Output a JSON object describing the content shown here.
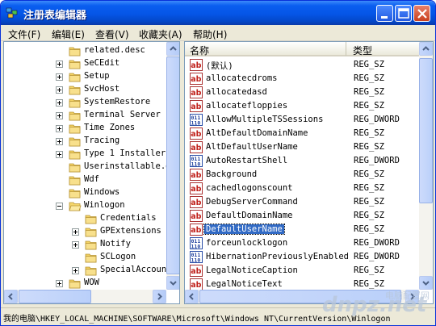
{
  "window": {
    "title": "注册表编辑器"
  },
  "menu": [
    {
      "label": "文件(F)"
    },
    {
      "label": "编辑(E)"
    },
    {
      "label": "查看(V)"
    },
    {
      "label": "收藏夹(A)"
    },
    {
      "label": "帮助(H)"
    }
  ],
  "tree": [
    {
      "label": "related.desc",
      "level": 0,
      "expander": "none"
    },
    {
      "label": "SeCEdit",
      "level": 0,
      "expander": "plus"
    },
    {
      "label": "Setup",
      "level": 0,
      "expander": "plus"
    },
    {
      "label": "SvcHost",
      "level": 0,
      "expander": "plus"
    },
    {
      "label": "SystemRestore",
      "level": 0,
      "expander": "plus"
    },
    {
      "label": "Terminal Server",
      "level": 0,
      "expander": "plus"
    },
    {
      "label": "Time Zones",
      "level": 0,
      "expander": "plus"
    },
    {
      "label": "Tracing",
      "level": 0,
      "expander": "plus"
    },
    {
      "label": "Type 1 Installer",
      "level": 0,
      "expander": "plus"
    },
    {
      "label": "Userinstallable.d",
      "level": 0,
      "expander": "none"
    },
    {
      "label": "Wdf",
      "level": 0,
      "expander": "none"
    },
    {
      "label": "Windows",
      "level": 0,
      "expander": "none"
    },
    {
      "label": "Winlogon",
      "level": 0,
      "expander": "minus",
      "open": true
    },
    {
      "label": "Credentials",
      "level": 1,
      "expander": "none"
    },
    {
      "label": "GPExtensions",
      "level": 1,
      "expander": "plus"
    },
    {
      "label": "Notify",
      "level": 1,
      "expander": "plus"
    },
    {
      "label": "SCLogon",
      "level": 1,
      "expander": "none"
    },
    {
      "label": "SpecialAccount",
      "level": 1,
      "expander": "plus"
    },
    {
      "label": "WOW",
      "level": 0,
      "expander": "plus"
    }
  ],
  "columns": {
    "name": "名称",
    "type": "类型"
  },
  "values": [
    {
      "name": "(默认)",
      "type": "REG_SZ",
      "kind": "sz"
    },
    {
      "name": "allocatecdroms",
      "type": "REG_SZ",
      "kind": "sz"
    },
    {
      "name": "allocatedasd",
      "type": "REG_SZ",
      "kind": "sz"
    },
    {
      "name": "allocatefloppies",
      "type": "REG_SZ",
      "kind": "sz"
    },
    {
      "name": "AllowMultipleTSSessions",
      "type": "REG_DWORD",
      "kind": "dword"
    },
    {
      "name": "AltDefaultDomainName",
      "type": "REG_SZ",
      "kind": "sz"
    },
    {
      "name": "AltDefaultUserName",
      "type": "REG_SZ",
      "kind": "sz"
    },
    {
      "name": "AutoRestartShell",
      "type": "REG_DWORD",
      "kind": "dword"
    },
    {
      "name": "Background",
      "type": "REG_SZ",
      "kind": "sz"
    },
    {
      "name": "cachedlogonscount",
      "type": "REG_SZ",
      "kind": "sz"
    },
    {
      "name": "DebugServerCommand",
      "type": "REG_SZ",
      "kind": "sz"
    },
    {
      "name": "DefaultDomainName",
      "type": "REG_SZ",
      "kind": "sz"
    },
    {
      "name": "DefaultUserName",
      "type": "REG_SZ",
      "kind": "sz",
      "selected": true
    },
    {
      "name": "forceunlocklogon",
      "type": "REG_DWORD",
      "kind": "dword"
    },
    {
      "name": "HibernationPreviouslyEnabled",
      "type": "REG_DWORD",
      "kind": "dword"
    },
    {
      "name": "LegalNoticeCaption",
      "type": "REG_SZ",
      "kind": "sz"
    },
    {
      "name": "LegalNoticeText",
      "type": "REG_SZ",
      "kind": "sz"
    }
  ],
  "status": {
    "path": "我的电脑\\HKEY_LOCAL_MACHINE\\SOFTWARE\\Microsoft\\Windows NT\\CurrentVersion\\Winlogon"
  },
  "watermark": {
    "brand": "dnpz.net",
    "caption": "电脑配置网"
  },
  "icons": {
    "app": "registry-icon",
    "minimize": "minimize-icon",
    "maximize": "maximize-icon",
    "close": "close-icon",
    "folder": "folder-icon",
    "string_value": "ab-string-value-icon",
    "dword_value": "binary-dword-value-icon"
  }
}
